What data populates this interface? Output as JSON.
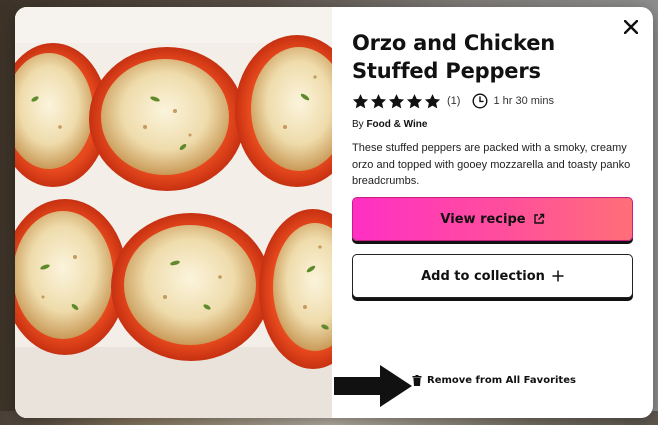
{
  "recipe": {
    "title": "Orzo and Chicken Stuffed Peppers",
    "rating_count": "(1)",
    "stars": 5,
    "cook_time": "1 hr 30 mins",
    "byline_prefix": "By ",
    "source": "Food & Wine",
    "description": "These stuffed peppers are packed with a smoky, creamy orzo and topped with gooey mozzarella and toasty panko breadcrumbs."
  },
  "actions": {
    "view_recipe_label": "View recipe",
    "add_collection_label": "Add to collection",
    "remove_label": "Remove from All Favorites"
  },
  "icons": {
    "close": "close-icon",
    "star": "star-icon",
    "clock": "clock-icon",
    "external": "external-link-icon",
    "plus": "plus-icon",
    "trash": "trash-icon"
  },
  "colors": {
    "view_recipe_gradient_start": "#ff2fc4",
    "view_recipe_gradient_end": "#ff6f78",
    "text": "#111111"
  }
}
